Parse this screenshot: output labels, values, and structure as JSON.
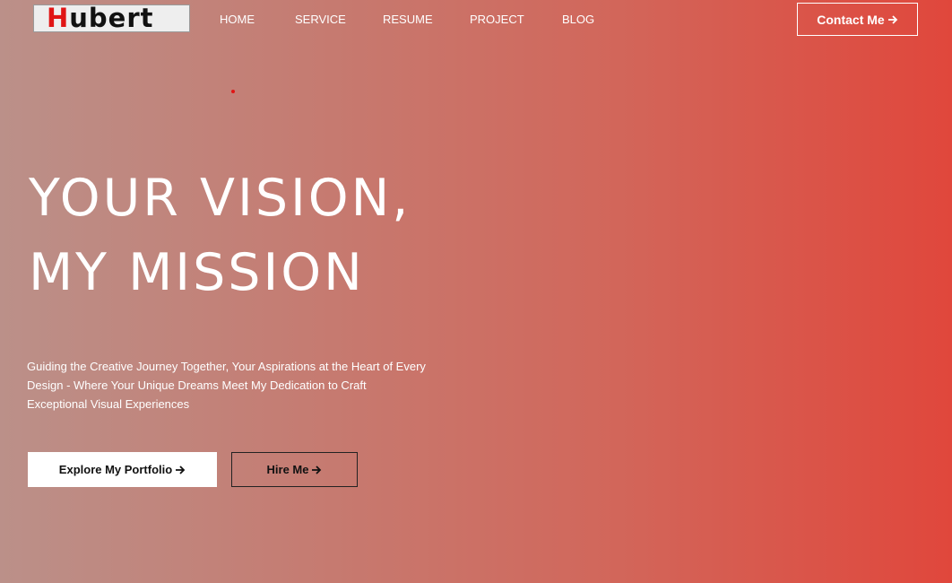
{
  "brand": {
    "logo_first_letter": "H",
    "logo_rest": "ubert",
    "accent_color": "#e01515"
  },
  "nav": {
    "items": [
      {
        "label": "HOME"
      },
      {
        "label": "SERVICE"
      },
      {
        "label": "RESUME"
      },
      {
        "label": "PROJECT"
      },
      {
        "label": "BLOG"
      }
    ]
  },
  "header": {
    "contact_label": "Contact Me",
    "contact_icon": "arrow-right-icon"
  },
  "hero": {
    "title_line_1": "YOUR VISION,",
    "title_line_2": "MY MISSION",
    "subtitle": "Guiding the Creative Journey Together, Your Aspirations at the Heart of Every Design - Where Your Unique Dreams Meet My Dedication to Craft Exceptional Visual Experiences",
    "primary_button_label": "Explore My Portfolio",
    "secondary_button_label": "Hire Me",
    "button_icon": "arrow-right-icon"
  },
  "colors": {
    "gradient_start": "#bb9089",
    "gradient_end": "#e0473c"
  }
}
